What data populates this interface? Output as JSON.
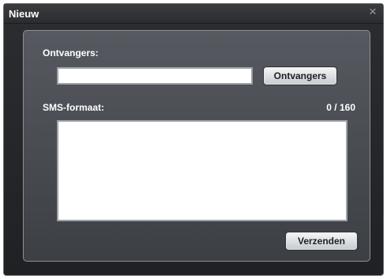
{
  "window": {
    "title": "Nieuw",
    "close_glyph": "×"
  },
  "recipients": {
    "label": "Ontvangers:",
    "input_value": "",
    "button_label": "Ontvangers"
  },
  "message": {
    "label": "SMS-formaat:",
    "counter": "0 / 160",
    "value": ""
  },
  "actions": {
    "send_label": "Verzenden"
  },
  "colors": {
    "window_bg": "#2b2d31",
    "panel_bg": "#565a60",
    "button_bg": "#e6e8ea",
    "text": "#ffffff"
  }
}
